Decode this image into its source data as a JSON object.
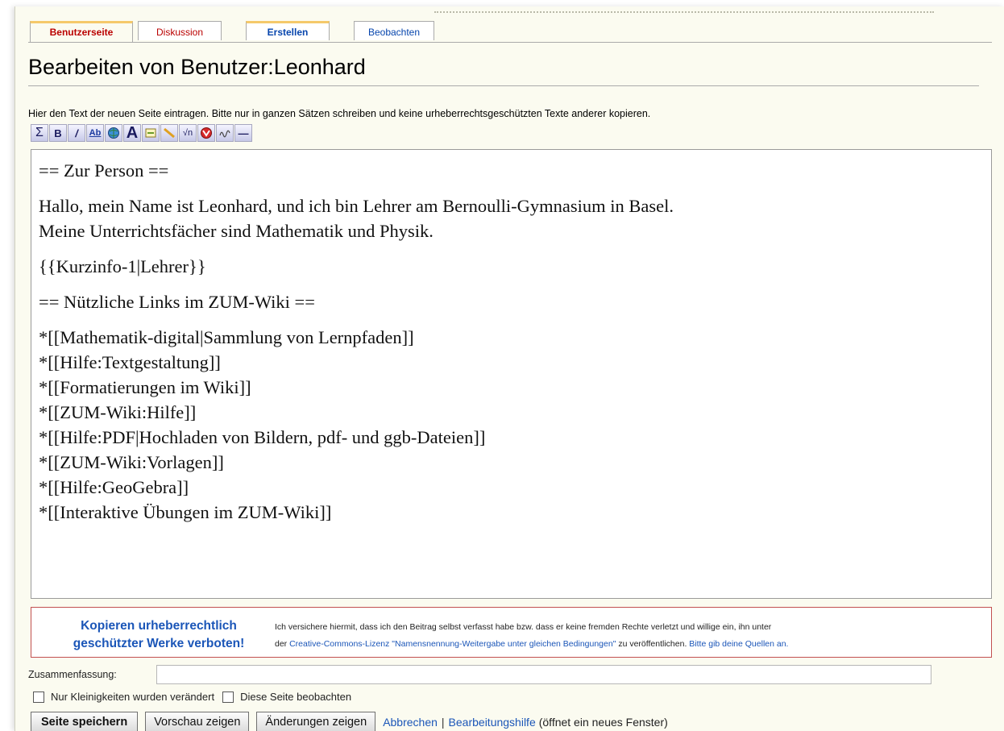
{
  "tabs": [
    {
      "label": "Benutzerseite"
    },
    {
      "label": "Diskussion"
    },
    {
      "label": "Erstellen"
    },
    {
      "label": "Beobachten"
    }
  ],
  "page": {
    "title": "Bearbeiten von Benutzer:Leonhard",
    "hint": "Hier den Text der neuen Seite eintragen. Bitte nur in ganzen Sätzen schreiben und keine urheberrechtsgeschützten Texte anderer kopieren."
  },
  "toolbar": {
    "buttons": [
      {
        "icon": "sigma-icon",
        "glyph": "Σ"
      },
      {
        "icon": "bold-icon",
        "glyph": "B"
      },
      {
        "icon": "italic-icon",
        "glyph": "/"
      },
      {
        "icon": "internal-link-icon",
        "glyph": "Ab"
      },
      {
        "icon": "globe-link-icon",
        "glyph": ""
      },
      {
        "icon": "headline-icon",
        "glyph": "A"
      },
      {
        "icon": "image-icon",
        "glyph": ""
      },
      {
        "icon": "media-icon",
        "glyph": ""
      },
      {
        "icon": "math-icon",
        "glyph": "√n"
      },
      {
        "icon": "nowiki-icon",
        "glyph": ""
      },
      {
        "icon": "signature-icon",
        "glyph": ""
      },
      {
        "icon": "horizontal-line-icon",
        "glyph": "—"
      }
    ]
  },
  "editor": {
    "blocks": [
      [
        "== Zur Person =="
      ],
      [
        "Hallo, mein Name ist Leonhard, und ich bin Lehrer am Bernoulli-Gymnasium in Basel.",
        "Meine Unterrichtsfächer sind Mathematik und Physik."
      ],
      [
        "{{Kurzinfo-1|Lehrer}}"
      ],
      [
        "== Nützliche Links im ZUM-Wiki =="
      ],
      [
        "*[[Mathematik-digital|Sammlung von Lernpfaden]]",
        "*[[Hilfe:Textgestaltung]]",
        "*[[Formatierungen im Wiki]]",
        "*[[ZUM-Wiki:Hilfe]]",
        "*[[Hilfe:PDF|Hochladen von Bildern, pdf- und ggb-Dateien]]",
        "*[[ZUM-Wiki:Vorlagen]]",
        "*[[Hilfe:GeoGebra]]",
        "*[[Interaktive Übungen im ZUM-Wiki]]"
      ]
    ]
  },
  "copyright": {
    "title_line1": "Kopieren urheberrechtlich",
    "title_line2": "geschützter Werke verboten!",
    "text_line1": "Ich versichere hiermit, dass ich den Beitrag selbst verfasst habe bzw. dass er keine fremden Rechte verletzt und willige ein, ihn unter",
    "text_line2_prefix": "der ",
    "text_line2_link": "Creative-Commons-Lizenz \"Namensnennung-Weitergabe unter gleichen Bedingungen\"",
    "text_line2_mid": " zu veröffentlichen. ",
    "text_line2_link2": "Bitte gib deine Quellen an."
  },
  "summary": {
    "label": "Zusammenfassung:",
    "value": ""
  },
  "options": {
    "minor_label": "Nur Kleinigkeiten wurden verändert",
    "watch_label": "Diese Seite beobachten"
  },
  "actions": {
    "save_label": "Seite speichern",
    "preview_label": "Vorschau zeigen",
    "diff_label": "Änderungen zeigen",
    "cancel_label": "Abbrechen",
    "separator": "|",
    "help_label": "Bearbeitungshilfe",
    "help_note": "(öffnet ein neues Fenster)"
  }
}
